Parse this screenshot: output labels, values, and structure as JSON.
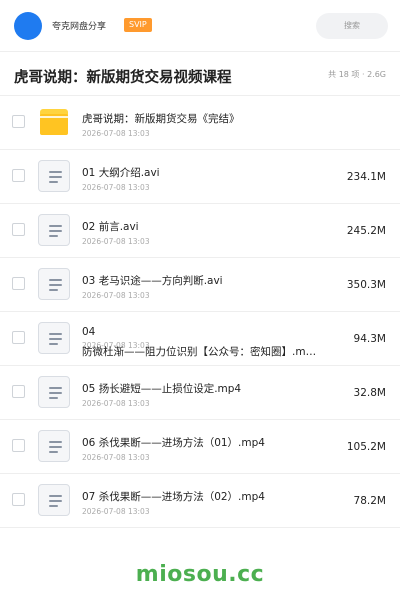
{
  "header": {
    "share_name": "夸克网盘分享",
    "badge": "SVIP",
    "search_placeholder": "搜索"
  },
  "title_bar": {
    "title": "虎哥说期：新版期货交易视频课程",
    "count": "共 18 项",
    "separator": "·",
    "size": "2.6G"
  },
  "files": [
    {
      "type": "folder",
      "name": "虎哥说期：新版期货交易《完结》",
      "date": "2026-07-08 13:03",
      "size": ""
    },
    {
      "type": "file",
      "name": "01 大纲介绍.avi",
      "date": "2026-07-08 13:03",
      "size": "234.1M"
    },
    {
      "type": "file",
      "name": "02 前言.avi",
      "date": "2026-07-08 13:03",
      "size": "245.2M"
    },
    {
      "type": "file",
      "name": "03 老马识途——方向判断.avi",
      "date": "2026-07-08 13:03",
      "size": "350.3M"
    },
    {
      "type": "file",
      "name_line1": "04",
      "name_line2": "防微杜渐——阻力位识别【公众号：密知圈】.m…",
      "date": "2026-07-08 13:03",
      "size": "94.3M"
    },
    {
      "type": "file",
      "name": "05 扬长避短——止损位设定.mp4",
      "date": "2026-07-08 13:03",
      "size": "32.8M"
    },
    {
      "type": "file",
      "name": "06 杀伐果断——进场方法（01）.mp4",
      "date": "2026-07-08 13:03",
      "size": "105.2M"
    },
    {
      "type": "file",
      "name": "07 杀伐果断——进场方法（02）.mp4",
      "date": "2026-07-08 13:03",
      "size": "78.2M"
    }
  ],
  "watermark": "miosou.cc",
  "colors": {
    "avatar": "#1f7bf0",
    "badge": "#ff9a2e",
    "folder": "#ffc422",
    "watermark": "#4caf50"
  }
}
